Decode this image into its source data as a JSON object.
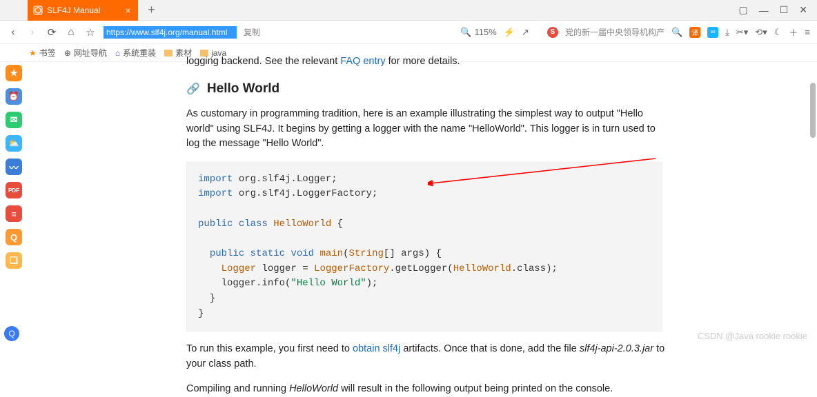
{
  "tab": {
    "title": "SLF4J Manual"
  },
  "window_controls": {
    "min": "—",
    "max": "☐",
    "close": "✕",
    "extra": "▢"
  },
  "toolbar": {
    "back": "‹",
    "forward": "›",
    "reload": "⟳",
    "home": "⌂",
    "star": "☆",
    "url": "https://www.slf4j.org/manual.html",
    "copy_label": "复制",
    "zoom_icon": "🔍",
    "zoom": "115%",
    "flash": "⚡",
    "share": "↗",
    "sogou_text": "党的新一届中央领导机构产",
    "search_glass": "🔍",
    "translate": "译",
    "infinity": "∞",
    "download": "⤓",
    "scissors": "✂▾",
    "undo": "⟲▾",
    "moon": "☾",
    "plus": "＋",
    "menu": "≡"
  },
  "bookmarks": {
    "star_label": "书签",
    "b1": {
      "icon": "⊕",
      "label": "网址导航"
    },
    "b2": {
      "icon": "⌂",
      "label": "系统重装"
    },
    "b3": {
      "label": "素材"
    },
    "b4": {
      "label": "java"
    }
  },
  "sidebar_glyphs": [
    "★",
    "⏰",
    "✉",
    "⛅",
    "〰",
    "PDF",
    "≡",
    "Q",
    "❏"
  ],
  "page": {
    "top_fragment_pre": "logging backend. See the relevant ",
    "faq_link": "FAQ entry",
    "top_fragment_post": " for more details.",
    "h2": "Hello World",
    "para1": "As customary in programming tradition, here is an example illustrating the simplest way to output \"Hello world\" using SLF4J. It begins by getting a logger with the name \"HelloWorld\". This logger is in turn used to log the message \"Hello World\".",
    "para2_pre": "To run this example, you first need to ",
    "para2_link": "obtain slf4j",
    "para2_mid": " artifacts. Once that is done, add the file ",
    "para2_jar": "slf4j-api-2.0.3.jar",
    "para2_post": " to your class path.",
    "para3_pre": "Compiling and running ",
    "para3_em": "HelloWorld",
    "para3_post": " will result in the following output being printed on the console."
  },
  "code": {
    "import_kw": "import",
    "imp1": " org.slf4j.Logger;",
    "imp2": " org.slf4j.LoggerFactory;",
    "public_kw": "public",
    "class_kw": "class",
    "class_name": "HelloWorld",
    "open_brace": " {",
    "static_kw": "static",
    "void_kw": "void",
    "main_name": "main",
    "main_args_open": "(",
    "string_type": "String",
    "main_args_rest": "[] args) {",
    "logger_type": "Logger",
    "logger_decl": " logger = ",
    "factory": "LoggerFactory",
    "getlogger_open": ".getLogger(",
    "hw_class": "HelloWorld",
    "getlogger_close": ".class);",
    "info_pre": "    logger.info(",
    "hello_str": "\"Hello World\"",
    "info_post": ");",
    "close_inner": "  }",
    "close_outer": "}",
    "indent2": "  ",
    "indent4": "    "
  },
  "watermark": "CSDN @Java rookie rookie"
}
